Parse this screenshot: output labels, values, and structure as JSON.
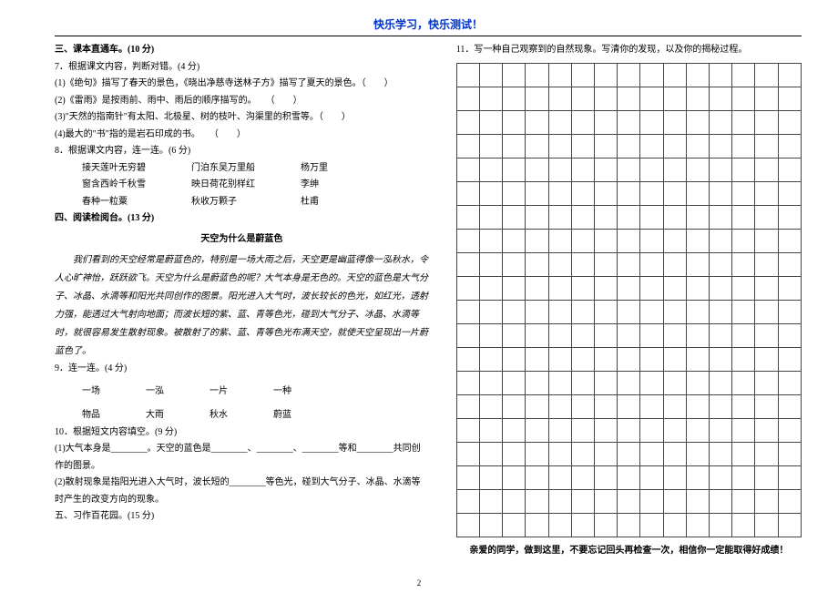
{
  "header": "快乐学习，快乐测试！",
  "left": {
    "s3_title": "三、课本直通车。(10 分)",
    "q7": "7．根据课文内容，判断对错。(4 分)",
    "q7_1": "(1)《绝句》描写了春天的景色，《晓出净慈寺送林子方》描写了夏天的景色。（　　）",
    "q7_2": "(2)《雷雨》是按雨前、雨中、雨后的顺序描写的。　　（　　）",
    "q7_3": "(3)\"天然的指南针\"有太阳、北极星、树的枝叶、沟渠里的积雪等。（　　）",
    "q7_4": "(4)最大的\"书\"指的是岩石印成的书。　　（　　）",
    "q8": "8．根据课文内容，连一连。(6 分)",
    "m1a": "接天莲叶无穷碧",
    "m1b": "门泊东吴万里船",
    "m1c": "杨万里",
    "m2a": "窗含西岭千秋雪",
    "m2b": "映日荷花别样红",
    "m2c": "李绅",
    "m3a": "春种一粒粟",
    "m3b": "秋收万颗子",
    "m3c": "杜甫",
    "s4_title": "四、阅读检阅台。(13 分)",
    "passage_title": "天空为什么是蔚蓝色",
    "p1": "我们看到的天空经常是蔚蓝色的，特别是一场大雨之后，天空更是幽蓝得像一泓秋水，令人心旷神怡，跃跃欲飞。天空为什么是蔚蓝色的呢？大气本身是无色的。天空的蓝色是大气分子、冰晶、水滴等和阳光共同创作的图景。阳光进入大气时，波长较长的色光，如红光，透射力强，能透过大气射向地面；而波长短的紫、蓝、青等色光，碰到大气分子、冰晶、水滴等时，就很容易发生散射现象。被散射了的紫、蓝、青等色光布满天空，就使天空呈现出一片蔚蓝色了。",
    "q9": "9．连一连。(4 分)",
    "w1": "一场",
    "w2": "一泓",
    "w3": "一片",
    "w4": "一种",
    "x1": "物品",
    "x2": "大雨",
    "x3": "秋水",
    "x4": "蔚蓝",
    "q10": "10．根据短文内容填空。(9 分)",
    "q10_1": "(1)大气本身是________。天空的蓝色是________、________、________等和________共同创作的图景。",
    "q10_2": "(2)散射现象是指阳光进入大气时，波长短的________等色光，碰到大气分子、冰晶、水滴等时产生的改变方向的现象。",
    "s5_title": "五、习作百花园。(15 分)"
  },
  "right": {
    "q11": "11．写一种自己观察到的自然现象。写清你的发现，以及你的揭秘过程。",
    "encourage": "亲爱的同学，做到这里，不要忘记回头再检查一次，相信你一定能取得好成绩！"
  },
  "pagenum": "2",
  "grid": {
    "rows": 20,
    "cols": 15
  }
}
